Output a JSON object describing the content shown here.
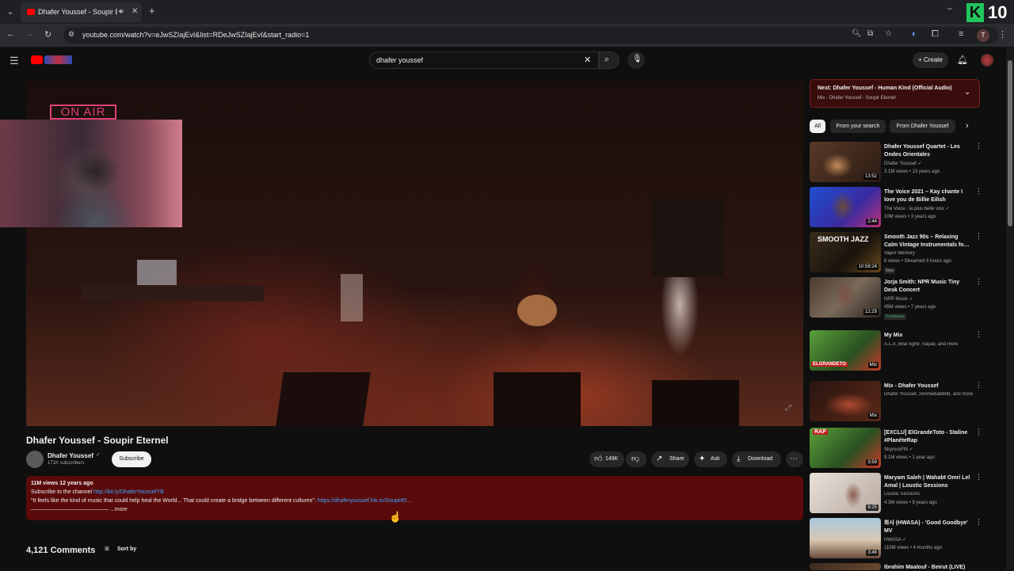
{
  "browser": {
    "tab_title": "Dhafer Youssef - Soupir Ete…",
    "url": "youtube.com/watch?v=eJwSZIajEvI&list=RDeJwSZIajEvI&start_radio=1",
    "overlay_number": "10",
    "overlay_letter": "K",
    "profile_initial": "T"
  },
  "header": {
    "search_value": "dhafer youssef",
    "create_label": "Create"
  },
  "video": {
    "on_air": "ON AIR",
    "title": "Dhafer Youssef - Soupir Eternel"
  },
  "channel": {
    "name": "Dhafer Youssef",
    "subscribers": "171K subscribers",
    "subscribe_label": "Subscribe"
  },
  "actions": {
    "likes": "149K",
    "share": "Share",
    "ask": "Ask",
    "download": "Download"
  },
  "description": {
    "stats": "11M views  12 years ago",
    "line1_text": "Subscribe to the channel ",
    "line1_link": "http://bit.ly/DhaferYoussefYB",
    "line2_text": "\"It feels like the kind of music that could help heal the World... That could create a bridge between different cultures\": ",
    "line2_link": "https://dhaferyoussef.lnk.to/SoupirEt...",
    "line3_text": "――――――――――――――   ...more"
  },
  "comments": {
    "count": "4,121 Comments",
    "sort_label": "Sort by"
  },
  "up_next": {
    "title": "Next: Dhafer Youssef - Human Kind (Official Audio)",
    "subtitle": "Mix - Dhafer Youssef - Soupir Eternel"
  },
  "chips": [
    "All",
    "From your search",
    "From Dhafer Youssef"
  ],
  "sidebar": {
    "items": [
      {
        "title": "Dhafer Youssef Quartet - Les Ondes Orientales",
        "channel": "Dhafer Youssef ✓",
        "meta": "3.1M views • 13 years ago",
        "duration": "13:52",
        "badge": ""
      },
      {
        "title": "The Voice 2021 – Kay chante I love you de Billie Eilish",
        "channel": "The Voice : la plus belle voix ✓",
        "meta": "10M views • 3 years ago",
        "duration": "2:44",
        "badge": ""
      },
      {
        "title": "Smooth Jazz 90s – Relaxing Calm Vintage Instrumentals fo…",
        "channel": "Vapor Memory",
        "meta": "8 views • Streamed 6 hours ago",
        "duration": "10:59:24",
        "badge": "New"
      },
      {
        "title": "Jorja Smith: NPR Music Tiny Desk Concert",
        "channel": "NPR Music ✓",
        "meta": "45M views • 7 years ago",
        "duration": "12:29",
        "badge": "Fundraiser"
      },
      {
        "title": "My Mix",
        "channel": "A.L.A, Bilal Sghir, Sayax, and more",
        "meta": "",
        "duration": "Mix",
        "badge": ""
      },
      {
        "title": "Mix - Dhafer Youssef",
        "channel": "Dhafer Youssef, zenmedia8888, and more",
        "meta": "",
        "duration": "Mix",
        "badge": ""
      },
      {
        "title": "[EXCLU] ElGrandeToto - Staline #PlanèteRap",
        "channel": "SkyrockFM ✓",
        "meta": "9.1M views • 1 year ago",
        "duration": "3:59",
        "badge": ""
      },
      {
        "title": "Maryam Saleh | Wahabt Omri Lel Amal | Loustic Sessions",
        "channel": "Loustic Sessions",
        "meta": "4.3M views • 9 years ago",
        "duration": "8:25",
        "badge": ""
      },
      {
        "title": "화사 (HWASA) - 'Good Goodbye' MV",
        "channel": "HWASA ✓",
        "meta": "110M views • 4 months ago",
        "duration": "3:46",
        "badge": ""
      },
      {
        "title": "Ibrahim Maalouf - Beirut (LIVE)",
        "channel": "",
        "meta": "",
        "duration": "",
        "badge": ""
      }
    ],
    "thumb_text": {
      "smooth_jazz": "SMOOTH JAZZ",
      "rap": "RAP",
      "elgrandeto": "ELGRANDETO"
    }
  },
  "colors": {
    "background": "#0f0f0f",
    "description_bg": "#5a0a0a",
    "link": "#3ea6ff",
    "on_air": "#e0407a",
    "youtube_red": "#ff0000",
    "overlay_green": "#22c55e"
  }
}
